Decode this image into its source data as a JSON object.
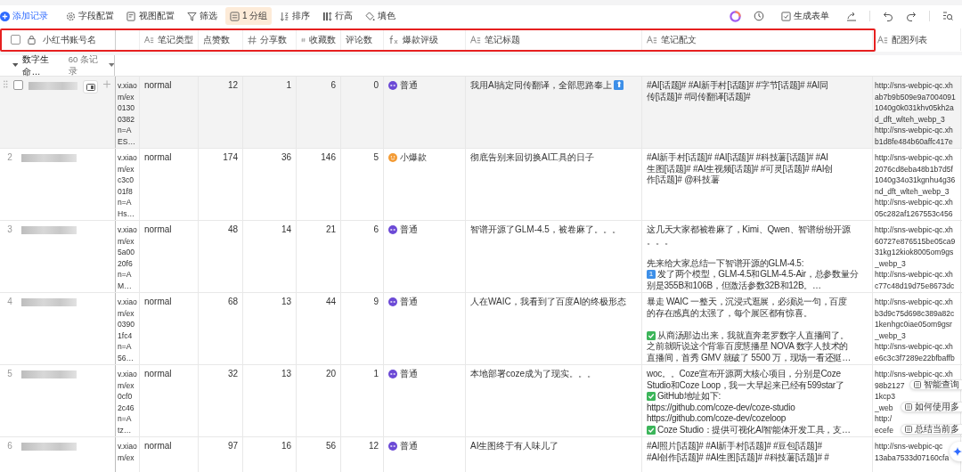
{
  "toolbar": {
    "items": [
      {
        "label": "添加记录",
        "kind": "add",
        "selected": false
      },
      {
        "label": "字段配置",
        "kind": "gear",
        "selected": false
      },
      {
        "label": "视图配置",
        "kind": "view",
        "selected": false
      },
      {
        "label": "筛选",
        "kind": "filter",
        "selected": false
      },
      {
        "label": "1 分组",
        "kind": "group",
        "selected": true
      },
      {
        "label": "排序",
        "kind": "sort",
        "selected": false
      },
      {
        "label": "行高",
        "kind": "height",
        "selected": false
      },
      {
        "label": "填色",
        "kind": "fill",
        "selected": false
      }
    ],
    "form_button": "生成表单"
  },
  "header_highlighted": true,
  "all_checked": false,
  "frozen_column": {
    "label": "小红书账号名"
  },
  "columns": [
    {
      "kind": "blank"
    },
    {
      "label": "笔记类型",
      "kind": "text"
    },
    {
      "label": "点赞数",
      "kind": "plain"
    },
    {
      "label": "分享数",
      "kind": "number"
    },
    {
      "label": "收藏数",
      "kind": "number"
    },
    {
      "label": "评论数",
      "kind": "plain"
    },
    {
      "label": "爆款评级",
      "kind": "formula"
    },
    {
      "label": "笔记标题",
      "kind": "text"
    },
    {
      "label": "笔记配文",
      "kind": "text"
    },
    {
      "label": "配图列表",
      "kind": "text"
    }
  ],
  "group": {
    "label": "数字生命…",
    "count": "60 条记录",
    "expanded": true
  },
  "rows": [
    {
      "hovered": true,
      "checked": false,
      "link": [
        "v.xiao",
        "m/ex",
        "0130",
        "0382",
        "n=A",
        "ES…"
      ],
      "type": "normal",
      "likes": "12",
      "shares": "1",
      "saves": "6",
      "comments": "0",
      "rating": {
        "label": "普通",
        "kind": "normal",
        "color": "#6c4ad6"
      },
      "title": "我用AI搞定同传翻译，全部思路奉上",
      "title_badge": "⬆",
      "caption": [
        {
          "text": "#AI[话题]# #AI新手村[话题]# #字节[话题]# #AI同"
        },
        {
          "text": "传[话题]# #同传翻译[话题]#"
        }
      ],
      "images": [
        "http://sns-webpic-qc.xh",
        "ab7b9b509e9a7004091",
        "1040g0k031khv05kh2a",
        "d_dft_wlteh_webp_3",
        "http://sns-webpic-qc.xh",
        "b1d8fe484b60affc417e"
      ]
    },
    {
      "number": "2",
      "hovered": false,
      "link": [
        "v.xiao",
        "m/ex",
        "c3c0",
        "01f8",
        "n=A",
        "Hs…"
      ],
      "type": "normal",
      "likes": "174",
      "shares": "36",
      "saves": "146",
      "comments": "5",
      "rating": {
        "label": "小爆款",
        "kind": "hot",
        "color": "#f39b35"
      },
      "title": "彻底告别来回切换AI工具的日子",
      "caption": [
        {
          "text": "#AI新手村[话题]# #AI[话题]# #科技薯[话题]# #AI"
        },
        {
          "text": "生图[话题]# #AI生视频[话题]# #可灵[话题]# #AI创"
        },
        {
          "text": "作[话题]# @科技薯"
        }
      ],
      "images": [
        "http://sns-webpic-qc.xh",
        "2076cd8eba48b1b7d5f",
        "1040g34o31kgnhu4g36",
        "nd_dft_wlteh_webp_3",
        "http://sns-webpic-qc.xh",
        "05c282af1267553c456"
      ]
    },
    {
      "number": "3",
      "hovered": false,
      "link": [
        "v.xiao",
        "m/ex",
        "5a00",
        "20f6",
        "n=A",
        "M…"
      ],
      "type": "normal",
      "likes": "48",
      "shares": "14",
      "saves": "21",
      "comments": "6",
      "rating": {
        "label": "普通",
        "kind": "normal",
        "color": "#6c4ad6"
      },
      "title": "智谱开源了GLM-4.5，被卷麻了。。。",
      "caption": [
        {
          "text": "这几天大家都被卷麻了，Kimi、Qwen、智谱纷纷开源"
        },
        {
          "text": "。。。"
        },
        {
          "kind": "blank"
        },
        {
          "text": "先来给大家总结一下智谱开源的GLM-4.5:"
        },
        {
          "kind": "keycap",
          "key": "1",
          "text": "发了两个模型，GLM-4.5和GLM-4.5-Air，总参数量分"
        },
        {
          "text": "别是355B和106B，但激活参数32B和12B。…"
        }
      ],
      "images": [
        "http://sns-webpic-qc.xh",
        "60727e876515be05ca9",
        "31kg12kiok8005om9gs",
        "_webp_3",
        "http://sns-webpic-qc.xh",
        "c77c48d19d75e8673dc"
      ]
    },
    {
      "number": "4",
      "hovered": false,
      "link": [
        "v.xiao",
        "m/ex",
        "0390",
        "1fc4",
        "n=A",
        "56…"
      ],
      "type": "normal",
      "likes": "68",
      "shares": "13",
      "saves": "44",
      "comments": "9",
      "rating": {
        "label": "普通",
        "kind": "normal",
        "color": "#6c4ad6"
      },
      "title": "人在WAIC，我看到了百度AI的终极形态",
      "caption": [
        {
          "text": "暴走 WAIC 一整天，沉浸式逛展，必须说一句，百度"
        },
        {
          "text": "的存在感真的太强了，每个展区都有惊喜。"
        },
        {
          "kind": "blank"
        },
        {
          "kind": "check",
          "text": "从商汤那边出来，我就直奔老罗数字人直播间了。"
        },
        {
          "text": "之前就听说这个背靠百度慧播星 NOVA 数字人技术的"
        },
        {
          "text": "直播间，首秀 GMV 就破了 5500 万，现场一看还挺…"
        }
      ],
      "images": [
        "http://sns-webpic-qc.xh",
        "b3d9c75d698c389a82c",
        "1kenhgc0iae05om9gsr",
        "_webp_3",
        "http://sns-webpic-qc.xh",
        "e6c3c3f7289e22bfbaffb"
      ]
    },
    {
      "number": "5",
      "hovered": false,
      "link": [
        "v.xiao",
        "m/ex",
        "0cf0",
        "2c46",
        "n=A",
        "tz…"
      ],
      "type": "normal",
      "likes": "32",
      "shares": "13",
      "saves": "20",
      "comments": "1",
      "rating": {
        "label": "普通",
        "kind": "normal",
        "color": "#6c4ad6"
      },
      "title": "本地部署coze成为了现实。。。",
      "caption": [
        {
          "text": "woc。。Coze宣布开源两大核心项目，分别是Coze"
        },
        {
          "text": "Studio和Coze Loop，我一大早起来已经有599star了"
        },
        {
          "kind": "check",
          "text": "GitHub地址如下:"
        },
        {
          "text": "https://github.com/coze-dev/coze-studio"
        },
        {
          "text": "https://github.com/coze-dev/cozeloop"
        },
        {
          "kind": "check",
          "text": "Coze Studio：提供可视化AI智能体开发工具，支…"
        }
      ],
      "images": [
        "http://sns-webpic-qc.xh",
        "98b2127",
        "1kcp3",
        "_web",
        "http:/",
        "ecefe"
      ]
    },
    {
      "number": "6",
      "hovered": false,
      "link": [
        "v.xiao",
        "m/ex"
      ],
      "type": "normal",
      "likes": "97",
      "shares": "16",
      "saves": "56",
      "comments": "12",
      "rating": {
        "label": "普通",
        "kind": "normal",
        "color": "#6c4ad6"
      },
      "title": "AI生图终于有人味儿了",
      "caption": [
        {
          "text": "#AI照片[话题]# #AI新手村[话题]# #豆包[话题]#"
        },
        {
          "text": "#AI创作[话题]# #AI生图[话题]# #科技薯[话题]# #"
        }
      ],
      "images": [
        "http://sns-webpic-qc",
        "13aba7533d07160cfa"
      ]
    }
  ],
  "assistant_suggestions": [
    "智能查询",
    "如何使用多",
    "总结当前多"
  ]
}
